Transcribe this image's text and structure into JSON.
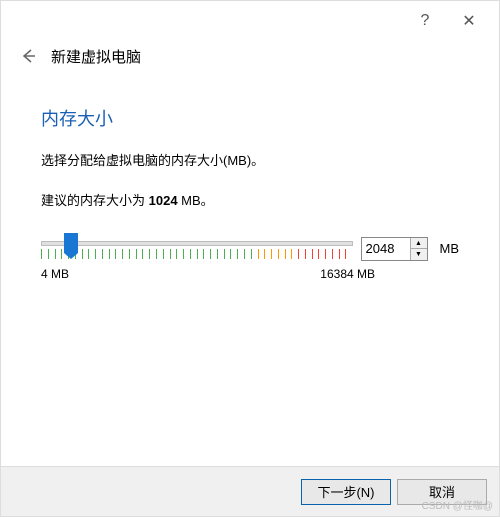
{
  "titlebar": {
    "help": "?",
    "close": "✕"
  },
  "header": {
    "back": "←",
    "title": "新建虚拟电脑"
  },
  "section": {
    "title": "内存大小",
    "description": "选择分配给虚拟电脑的内存大小(MB)。",
    "recommend_prefix": "建议的内存大小为 ",
    "recommend_value": "1024",
    "recommend_suffix": " MB。"
  },
  "slider": {
    "min_label": "4 MB",
    "max_label": "16384 MB",
    "value": "2048",
    "unit": "MB"
  },
  "footer": {
    "next": "下一步(N)",
    "cancel": "取消"
  },
  "watermark": "CSDN @怪咖@"
}
